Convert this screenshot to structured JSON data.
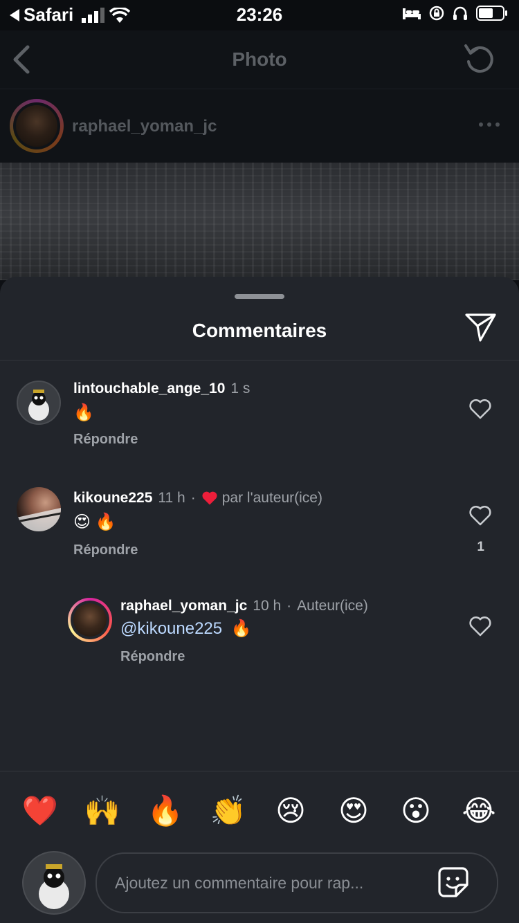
{
  "status_bar": {
    "back_app": "Safari",
    "time": "23:26"
  },
  "nav": {
    "title": "Photo"
  },
  "post": {
    "username": "raphael_yoman_jc"
  },
  "sheet": {
    "title": "Commentaires"
  },
  "comments": [
    {
      "username": "lintouchable_ange_10",
      "time": "1 s",
      "text": "🔥",
      "reply_label": "Répondre"
    },
    {
      "username": "kikoune225",
      "time": "11 h",
      "separator": "·",
      "liked_by_author": "par l'auteur(ice)",
      "text": "😍 🔥",
      "reply_label": "Répondre",
      "like_count": "1"
    },
    {
      "username": "raphael_yoman_jc",
      "time": "10 h",
      "separator": "·",
      "badge": "Auteur(ice)",
      "mention": "@kikoune225",
      "text": "🔥",
      "reply_label": "Répondre"
    }
  ],
  "emoji_bar": [
    "❤️",
    "🙌",
    "🔥",
    "👏",
    "😢",
    "😍",
    "😮",
    "😂"
  ],
  "composer": {
    "placeholder": "Ajoutez un commentaire pour rap..."
  },
  "colors": {
    "like_red": "#ed1e3a",
    "mention_blue": "#bcd9ff",
    "sheet_bg": "#22252b"
  }
}
